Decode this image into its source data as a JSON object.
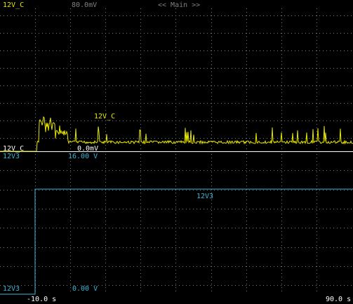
{
  "header": {
    "channel_label": "12V_C",
    "scale": "80.0mV",
    "view": "<< Main >>"
  },
  "channels": [
    {
      "name": "12V_C",
      "color": "#e6e600",
      "trace_label": "12V_C",
      "scale_label": "80.0mV",
      "offset_label": "0.0mV",
      "ground_marker": "12V_C"
    },
    {
      "name": "12V3",
      "color": "#3ab7d8",
      "trace_label": "12V3",
      "scale_label": "16.00 V",
      "offset_label": "0.00 V",
      "top_marker": "12V3",
      "ground_marker": "12V3"
    }
  ],
  "time_axis": {
    "start": "-10.0 s",
    "end": "90.0 s"
  },
  "colors": {
    "background": "#000000",
    "grid": "#7a7a7a",
    "divider": "#ffffff",
    "channel1": "#e6e600",
    "channel2": "#3ab7d8"
  }
}
